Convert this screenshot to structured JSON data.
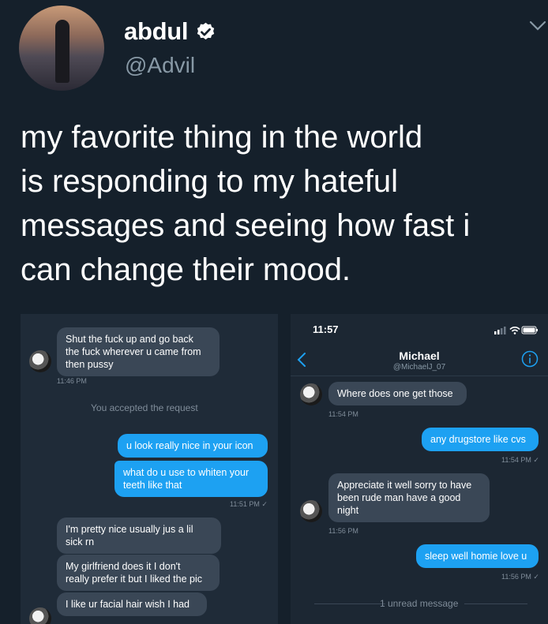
{
  "tweet": {
    "display_name": "abdul",
    "handle": "@Advil",
    "verified_icon": "verified-badge-icon",
    "menu_icon": "chevron-down-icon",
    "text_lines": [
      "my favorite thing in the world",
      "is responding to my hateful",
      "messages and seeing how fast i",
      "can change their mood."
    ]
  },
  "left_screenshot": {
    "msg1_lines": [
      "Shut the fuck up and go back",
      "the fuck wherever u came from",
      "then pussy"
    ],
    "ts1": "11:46 PM",
    "accepted_note": "You accepted the request",
    "sent1": "u look really nice in your icon",
    "sent2_lines": [
      "what do u use to whiten your",
      "teeth like that"
    ],
    "ts2": "11:51 PM ✓",
    "msg2_lines": [
      "I'm pretty nice usually jus a lil",
      "sick rn"
    ],
    "msg3_lines": [
      "My girlfriend does it I don't",
      "really prefer it but I liked the pic"
    ],
    "msg4": "I like ur facial hair wish I had"
  },
  "right_screenshot": {
    "status_time": "11:57",
    "contact_name": "Michael",
    "contact_handle": "@MichaelJ_07",
    "msg1": "Where does one get those",
    "ts1": "11:54 PM",
    "sent1": "any drugstore like cvs",
    "ts2": "11:54 PM ✓",
    "msg2_lines": [
      "Appreciate it well sorry to have",
      "been rude man have a good",
      "night"
    ],
    "ts3": "11:56 PM",
    "sent2": "sleep well homie love u",
    "ts4": "11:56 PM ✓",
    "unread_note": "1 unread message"
  },
  "colors": {
    "background": "#15202b",
    "accent": "#1da1f2",
    "incoming_bubble": "#3a4756",
    "muted_text": "#8899a6"
  }
}
